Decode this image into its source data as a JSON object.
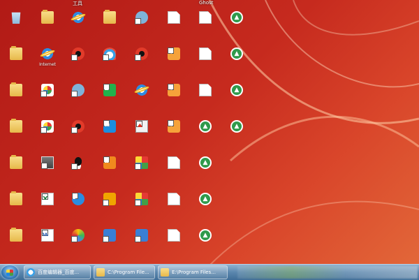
{
  "desktop": {
    "top_labels": [
      "工具",
      "Ghost"
    ],
    "icons": [
      {
        "col": 0,
        "row": 0,
        "glyph": "g-recycle",
        "name": "recycle-bin-icon",
        "label": ""
      },
      {
        "col": 1,
        "row": 0,
        "glyph": "g-folder",
        "name": "folder-icon",
        "label": ""
      },
      {
        "col": 2,
        "row": 0,
        "glyph": "g-ie",
        "name": "app-icon",
        "label": ""
      },
      {
        "col": 3,
        "row": 0,
        "glyph": "g-folder",
        "name": "folder-icon",
        "label": ""
      },
      {
        "col": 4,
        "row": 0,
        "glyph": "g-gear",
        "name": "app-icon",
        "label": ""
      },
      {
        "col": 5,
        "row": 0,
        "glyph": "g-doc",
        "name": "document-icon",
        "label": ""
      },
      {
        "col": 6,
        "row": 0,
        "glyph": "g-doc",
        "name": "document-icon",
        "label": ""
      },
      {
        "col": 7,
        "row": 0,
        "glyph": "g-up",
        "name": "installer-icon",
        "label": ""
      },
      {
        "col": 0,
        "row": 1,
        "glyph": "g-folder",
        "name": "folder-icon",
        "label": ""
      },
      {
        "col": 1,
        "row": 1,
        "glyph": "g-ie",
        "name": "internet-explorer-icon",
        "label": "Internet"
      },
      {
        "col": 2,
        "row": 1,
        "glyph": "g-red",
        "name": "app-icon",
        "label": ""
      },
      {
        "col": 3,
        "row": 1,
        "glyph": "g-cloud",
        "name": "app-icon",
        "label": ""
      },
      {
        "col": 4,
        "row": 1,
        "glyph": "g-red",
        "name": "app-icon",
        "label": ""
      },
      {
        "col": 5,
        "row": 1,
        "glyph": "g-music",
        "name": "audio-file-icon",
        "label": ""
      },
      {
        "col": 6,
        "row": 1,
        "glyph": "g-doc",
        "name": "document-icon",
        "label": ""
      },
      {
        "col": 7,
        "row": 1,
        "glyph": "g-up",
        "name": "installer-icon",
        "label": ""
      },
      {
        "col": 0,
        "row": 2,
        "glyph": "g-folder",
        "name": "folder-icon",
        "label": ""
      },
      {
        "col": 1,
        "row": 2,
        "glyph": "g-apk",
        "name": "apk-icon",
        "label": ""
      },
      {
        "col": 2,
        "row": 2,
        "glyph": "g-gear",
        "name": "app-icon",
        "label": ""
      },
      {
        "col": 3,
        "row": 2,
        "glyph": "g-green",
        "name": "app-icon",
        "label": ""
      },
      {
        "col": 4,
        "row": 2,
        "glyph": "g-ie",
        "name": "app-icon",
        "label": ""
      },
      {
        "col": 5,
        "row": 2,
        "glyph": "g-music",
        "name": "audio-file-icon",
        "label": ""
      },
      {
        "col": 6,
        "row": 2,
        "glyph": "g-doc",
        "name": "document-icon",
        "label": ""
      },
      {
        "col": 7,
        "row": 2,
        "glyph": "g-up",
        "name": "installer-icon",
        "label": ""
      },
      {
        "col": 0,
        "row": 3,
        "glyph": "g-folder",
        "name": "folder-icon",
        "label": ""
      },
      {
        "col": 1,
        "row": 3,
        "glyph": "g-apk",
        "name": "apk-icon",
        "label": ""
      },
      {
        "col": 2,
        "row": 3,
        "glyph": "g-red",
        "name": "app-icon",
        "label": ""
      },
      {
        "col": 3,
        "row": 3,
        "glyph": "g-blue",
        "name": "app-icon",
        "label": ""
      },
      {
        "col": 4,
        "row": 3,
        "glyph": "g-cards",
        "name": "game-icon",
        "label": ""
      },
      {
        "col": 5,
        "row": 3,
        "glyph": "g-music",
        "name": "audio-file-icon",
        "label": ""
      },
      {
        "col": 6,
        "row": 3,
        "glyph": "g-up",
        "name": "installer-icon",
        "label": ""
      },
      {
        "col": 7,
        "row": 3,
        "glyph": "g-up",
        "name": "installer-icon",
        "label": ""
      },
      {
        "col": 0,
        "row": 4,
        "glyph": "g-folder",
        "name": "folder-icon",
        "label": ""
      },
      {
        "col": 1,
        "row": 4,
        "glyph": "g-photo",
        "name": "image-file-icon",
        "label": ""
      },
      {
        "col": 2,
        "row": 4,
        "glyph": "g-penguin",
        "name": "qq-icon",
        "label": ""
      },
      {
        "col": 3,
        "row": 4,
        "glyph": "g-orange",
        "name": "app-icon",
        "label": ""
      },
      {
        "col": 4,
        "row": 4,
        "glyph": "g-pinwheel",
        "name": "app-icon",
        "label": ""
      },
      {
        "col": 5,
        "row": 4,
        "glyph": "g-doc",
        "name": "document-icon",
        "label": ""
      },
      {
        "col": 6,
        "row": 4,
        "glyph": "g-up",
        "name": "installer-icon",
        "label": ""
      },
      {
        "col": 0,
        "row": 5,
        "glyph": "g-folder",
        "name": "folder-icon",
        "label": ""
      },
      {
        "col": 1,
        "row": 5,
        "glyph": "g-xls",
        "name": "spreadsheet-icon",
        "label": ""
      },
      {
        "col": 2,
        "row": 5,
        "glyph": "g-play",
        "name": "media-player-icon",
        "label": ""
      },
      {
        "col": 3,
        "row": 5,
        "glyph": "g-raccoon",
        "name": "app-icon",
        "label": ""
      },
      {
        "col": 4,
        "row": 5,
        "glyph": "g-pinwheel",
        "name": "app-icon",
        "label": ""
      },
      {
        "col": 5,
        "row": 5,
        "glyph": "g-doc",
        "name": "document-icon",
        "label": ""
      },
      {
        "col": 6,
        "row": 5,
        "glyph": "g-up",
        "name": "installer-icon",
        "label": ""
      },
      {
        "col": 0,
        "row": 6,
        "glyph": "g-folder",
        "name": "folder-icon",
        "label": ""
      },
      {
        "col": 1,
        "row": 6,
        "glyph": "g-word",
        "name": "word-document-icon",
        "label": ""
      },
      {
        "col": 2,
        "row": 6,
        "glyph": "g-disc",
        "name": "app-icon",
        "label": ""
      },
      {
        "col": 3,
        "row": 6,
        "glyph": "g-wave",
        "name": "app-icon",
        "label": ""
      },
      {
        "col": 4,
        "row": 6,
        "glyph": "g-wave",
        "name": "app-icon",
        "label": ""
      },
      {
        "col": 5,
        "row": 6,
        "glyph": "g-doc",
        "name": "document-icon",
        "label": ""
      },
      {
        "col": 6,
        "row": 6,
        "glyph": "g-up",
        "name": "installer-icon",
        "label": ""
      }
    ]
  },
  "taskbar": {
    "start_label": "start",
    "tasks": [
      {
        "icon": "ti-app",
        "label": "百度编辑器_百度..."
      },
      {
        "icon": "ti-folder",
        "label": "C:\\Program File..."
      },
      {
        "icon": "ti-folder",
        "label": "E:\\Program Files..."
      }
    ]
  }
}
